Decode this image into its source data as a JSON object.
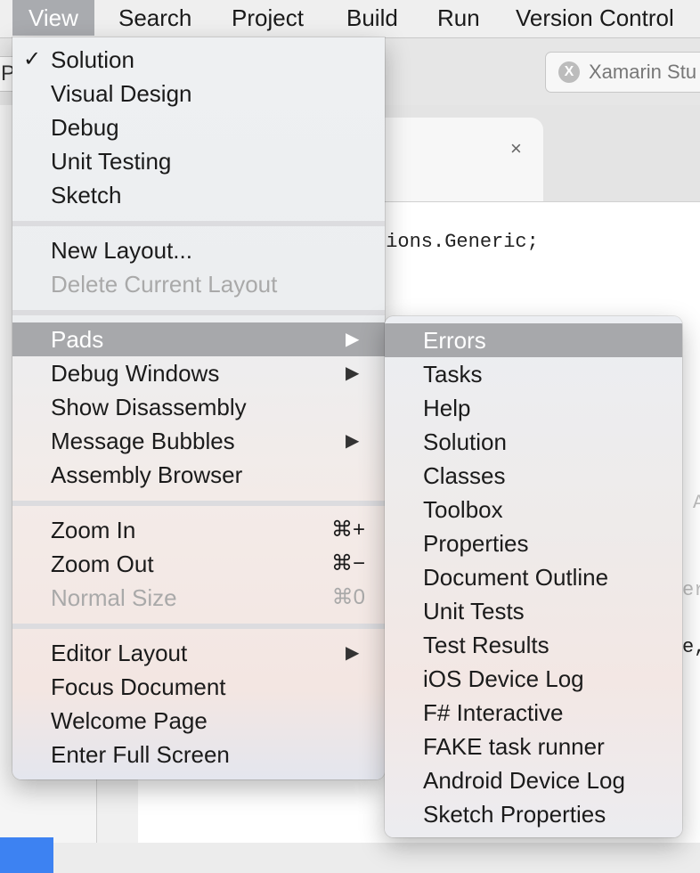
{
  "menubar": {
    "items": [
      "View",
      "Search",
      "Project",
      "Build",
      "Run",
      "Version Control"
    ]
  },
  "toolbar": {
    "left_stub": "Pr",
    "status_label": "Xamarin Stu",
    "status_logo": "X"
  },
  "editor": {
    "tab_close": "×",
    "code_line": "tions.Generic;",
    "fragments": [
      "A",
      "er",
      "e,"
    ]
  },
  "view_menu": {
    "items": [
      {
        "label": "Solution",
        "checked": true,
        "check": "✓"
      },
      {
        "label": "Visual Design"
      },
      {
        "label": "Debug"
      },
      {
        "label": "Unit Testing"
      },
      {
        "label": "Sketch"
      },
      {
        "label": "New Layout..."
      },
      {
        "label": "Delete Current Layout",
        "disabled": true
      },
      {
        "label": "Pads",
        "submenu": true,
        "highlighted": true
      },
      {
        "label": "Debug Windows",
        "submenu": true
      },
      {
        "label": "Show Disassembly"
      },
      {
        "label": "Message Bubbles",
        "submenu": true
      },
      {
        "label": "Assembly Browser"
      },
      {
        "label": "Zoom In",
        "shortcut": "⌘+"
      },
      {
        "label": "Zoom Out",
        "shortcut": "⌘−"
      },
      {
        "label": "Normal Size",
        "shortcut": "⌘0",
        "disabled": true
      },
      {
        "label": "Editor Layout",
        "submenu": true
      },
      {
        "label": "Focus Document"
      },
      {
        "label": "Welcome Page"
      },
      {
        "label": "Enter Full Screen"
      }
    ],
    "submenu_arrow": "▶"
  },
  "pads_menu": {
    "items": [
      {
        "label": "Errors",
        "highlighted": true
      },
      {
        "label": "Tasks"
      },
      {
        "label": "Help"
      },
      {
        "label": "Solution"
      },
      {
        "label": "Classes"
      },
      {
        "label": "Toolbox"
      },
      {
        "label": "Properties"
      },
      {
        "label": "Document Outline"
      },
      {
        "label": "Unit Tests"
      },
      {
        "label": "Test Results"
      },
      {
        "label": "iOS Device Log"
      },
      {
        "label": "F# Interactive"
      },
      {
        "label": "FAKE task runner"
      },
      {
        "label": "Android Device Log"
      },
      {
        "label": "Sketch Properties"
      }
    ]
  },
  "colors": {
    "highlight": "#a7a8ab",
    "disabled_text": "#a9a9a9",
    "selection_blue": "#3d82f2"
  }
}
